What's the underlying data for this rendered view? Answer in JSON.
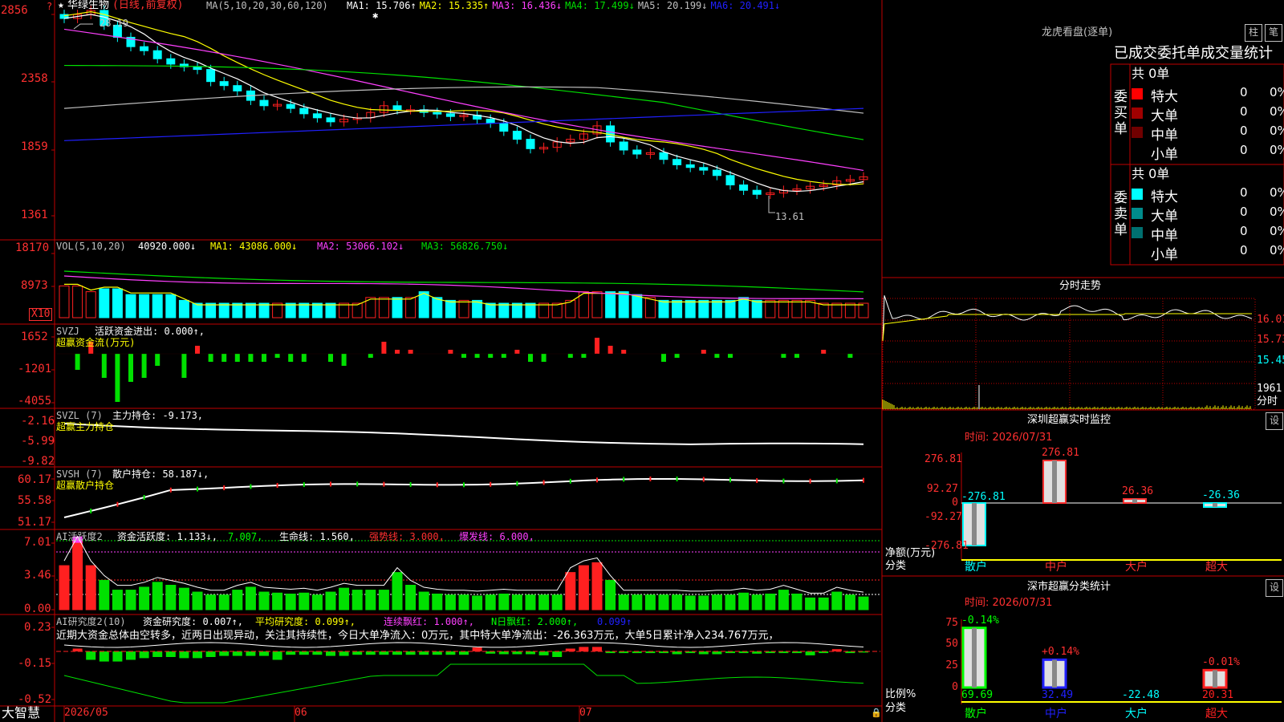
{
  "colors": {
    "up": "#ff2020",
    "down": "#00ffff",
    "grid": "#c00000",
    "axis": "#ff3030",
    "white": "#ffffff",
    "yellow": "#ffff00",
    "magenta": "#ff40ff",
    "green": "#00e000",
    "blue": "#2020ff",
    "gray": "#c0c0c0",
    "cyan": "#00ffff"
  },
  "main": {
    "stock_name": "华绿生物",
    "period": "(日线,前复权)",
    "ma_label": "MA(5,10,20,30,60,120)",
    "ma_items": [
      {
        "text": "MA1: 15.706↑",
        "color": "#ffffff"
      },
      {
        "text": "MA2: 15.335↑",
        "color": "#ffff00"
      },
      {
        "text": "MA3: 16.436↓",
        "color": "#ff40ff"
      },
      {
        "text": "MA4: 17.499↓",
        "color": "#00e000"
      },
      {
        "text": "MA5: 20.199↓",
        "color": "#c0c0c0"
      },
      {
        "text": "MA6: 20.491↓",
        "color": "#2020ff"
      }
    ],
    "y_ticks": [
      "2856",
      "2358",
      "1859",
      "1361"
    ],
    "high_label": "28.19",
    "low_label": "13.61"
  },
  "vol": {
    "label": "VOL(5,10,20)",
    "value": "40920.000↓",
    "ma1": "MA1: 43086.000↓",
    "ma2": "MA2: 53066.102↓",
    "ma3": "MA3: 56826.750↓",
    "y_ticks": [
      "18170",
      "8973"
    ],
    "unit": "X10"
  },
  "svzj": {
    "label": "SVZJ",
    "desc": "活跃资金进出: 0.000↑,",
    "sub": "超赢资金流(万元)",
    "y_ticks": [
      "1652",
      "-1201",
      "-4055"
    ]
  },
  "svzl": {
    "label": "SVZL (7)",
    "desc": "主力持仓: -9.173,",
    "sub": "超赢主力持仓",
    "y_ticks": [
      "-2.16",
      "-5.99",
      "-9.82"
    ]
  },
  "svsh": {
    "label": "SVSH (7)",
    "desc": "散户持仓: 58.187↓,",
    "sub": "超赢散户持仓",
    "y_ticks": [
      "60.17",
      "55.58",
      "51.17"
    ]
  },
  "ai1": {
    "label": "AI活跃度2",
    "desc": "资金活跃度: 1.133↓,",
    "v2": "7.007,",
    "life": "生命线: 1.560,",
    "strong": "强势线: 3.000,",
    "burst": "爆发线: 6.000,",
    "y_ticks": [
      "7.01",
      "3.46",
      "0.00"
    ]
  },
  "ai2": {
    "label": "AI研究度2(10)",
    "desc": "资金研究度: 0.007↑,",
    "avg": "平均研究度: 0.099↑,",
    "cont": "连续飘红: 1.000↑,",
    "nday": "N日飘红: 2.000↑,",
    "last": "0.099↑",
    "note": "近期大资金总体由空转多，近两日出现异动，关注其持续性，今日大单净流入：0万元，其中特大单净流出：-26.363万元，大单5日累计净入234.767万元，",
    "y_ticks": [
      "0.23",
      "-0.15",
      "-0.52"
    ]
  },
  "bottom": {
    "brand": "大智慧",
    "dates": [
      "2026/05",
      "06",
      "07"
    ]
  },
  "dragon": {
    "title": "龙虎看盘(逐单)",
    "btn1": "柱",
    "btn2": "笔",
    "header": "已成交委托单成交量统计",
    "buy_label": "委买单",
    "sell_label": "委卖单",
    "buy_total": "共 0单",
    "sell_total": "共 0单",
    "buy_rows": [
      {
        "name": "特大",
        "val": "0",
        "pct": "0%",
        "color": "#ff0000"
      },
      {
        "name": "大单",
        "val": "0",
        "pct": "0%",
        "color": "#a00000"
      },
      {
        "name": "中单",
        "val": "0",
        "pct": "0%",
        "color": "#700000"
      },
      {
        "name": "小单",
        "val": "0",
        "pct": "0%",
        "color": "#000000"
      }
    ],
    "sell_rows": [
      {
        "name": "特大",
        "val": "0",
        "pct": "0%",
        "color": "#00ffff"
      },
      {
        "name": "大单",
        "val": "0",
        "pct": "0%",
        "color": "#008c8c"
      },
      {
        "name": "中单",
        "val": "0",
        "pct": "0%",
        "color": "#007070"
      },
      {
        "name": "小单",
        "val": "0",
        "pct": "0%",
        "color": "#000000"
      }
    ]
  },
  "intraday": {
    "title": "分时走势",
    "y_ticks": [
      "16.01",
      "15.73",
      "15.45"
    ],
    "vol_tick": "1961",
    "unit": "分时"
  },
  "monitor": {
    "title": "深圳超赢实时监控",
    "btn": "设",
    "time": "时间: 2026/07/31",
    "y_ticks": [
      "276.81",
      "92.27",
      "0",
      "-92.27",
      "-276.81"
    ],
    "side1": "净额(万元)",
    "side2": "分类",
    "bars": [
      {
        "cat": "散户",
        "value": -276.81,
        "label": "-276.81"
      },
      {
        "cat": "中户",
        "value": 276.81,
        "label": "276.81"
      },
      {
        "cat": "大户",
        "value": 26.36,
        "label": "26.36"
      },
      {
        "cat": "超大",
        "value": -26.36,
        "label": "-26.36"
      }
    ]
  },
  "classify": {
    "title": "深市超赢分类统计",
    "btn": "设",
    "time": "时间: 2026/07/31",
    "y_ticks": [
      "75",
      "50",
      "25",
      "0"
    ],
    "side1": "比例%",
    "side2": "分类",
    "bars": [
      {
        "cat": "散户",
        "value": 69.69,
        "label": "69.69",
        "delta": "-0.14%"
      },
      {
        "cat": "中户",
        "value": 32.49,
        "label": "32.49",
        "delta": "+0.14%"
      },
      {
        "cat": "大户",
        "value": -22.48,
        "label": "-22.48",
        "delta": ""
      },
      {
        "cat": "超大",
        "value": 20.31,
        "label": "20.31",
        "delta": "-0.01%"
      }
    ]
  }
}
